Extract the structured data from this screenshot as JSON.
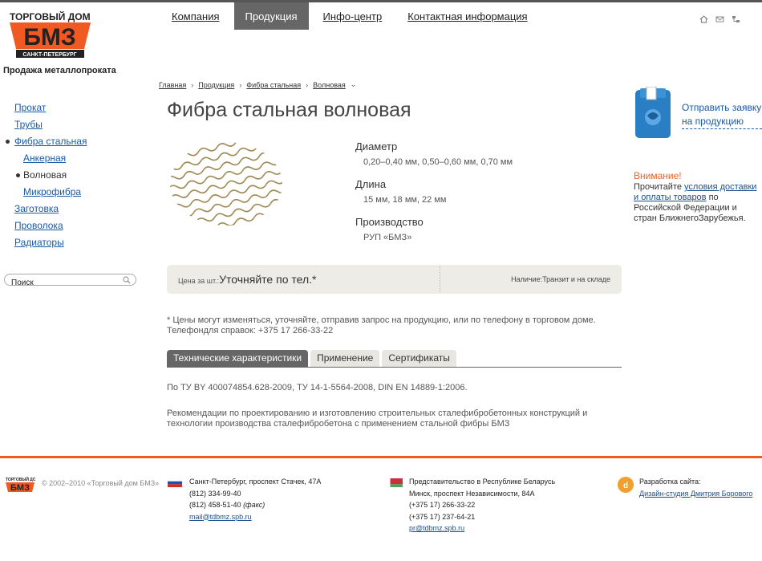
{
  "brand": {
    "logo_top": "ТОРГОВЫЙ ДОМ",
    "logo_main": "БМЗ",
    "logo_city": "САНКТ-ПЕТЕРБУРГ",
    "tagline": "Продажа металлопроката"
  },
  "topnav": [
    {
      "label": "Компания",
      "active": false
    },
    {
      "label": "Продукция",
      "active": true
    },
    {
      "label": "Инфо-центр",
      "active": false
    },
    {
      "label": "Контактная информация",
      "active": false
    }
  ],
  "top_icons": [
    "home-icon",
    "mail-icon",
    "sitemap-icon"
  ],
  "sidebar": {
    "items": [
      {
        "label": "Прокат"
      },
      {
        "label": "Трубы"
      },
      {
        "label": "Фибра стальная"
      },
      {
        "label": "Анкерная"
      },
      {
        "label": "Волновая"
      },
      {
        "label": "Микрофибра"
      },
      {
        "label": "Заготовка"
      },
      {
        "label": "Проволока"
      },
      {
        "label": "Радиаторы"
      }
    ]
  },
  "search": {
    "value": "Поиск"
  },
  "breadcrumb": [
    "Главная",
    "Продукция",
    "Фибра стальная",
    "Волновая"
  ],
  "title": "Фибра стальная волновая",
  "properties": [
    {
      "label": "Диаметр",
      "value": "0,20–0,40 мм, 0,50–0,60 мм, 0,70 мм"
    },
    {
      "label": "Длина",
      "value": "15 мм, 18 мм, 22 мм"
    },
    {
      "label": "Производство",
      "value": "РУП «БМЗ»"
    }
  ],
  "price": {
    "label": "Цена за шт.:",
    "value": "Уточняйте по тел.*",
    "availability_label": "Наличие:",
    "availability_value": "Транзит и на складе"
  },
  "note": {
    "line1": "* Цены могут изменяться, уточняйте, отправив запрос на продукцию, или по телефону в торговом доме.",
    "line2": "Телефондля справок: +375 17 266-33-22"
  },
  "tabs": [
    {
      "label": "Технические характеристики",
      "active": true
    },
    {
      "label": "Применение",
      "active": false
    },
    {
      "label": "Сертификаты",
      "active": false
    }
  ],
  "tab_content": {
    "standards": "По ТУ BY 400074854.628-2009, ТУ 14-1-5564-2008, DIN EN 14889-1:2006.",
    "recommendations": "Рекомендации по проектированию и изготовлению строительных сталефибробетонных конструкций и технологии производства сталефибробетона с применением стальной фибры БМЗ"
  },
  "promo": {
    "link": "Отправить заявку на продукцию"
  },
  "attention": {
    "title": "Внимание!",
    "pre": "Прочитайте ",
    "link": "условия доставки и оплаты товаров",
    "post": " по Российской Федерации и стран БлижнегоЗарубежья."
  },
  "footer": {
    "copyright": "© 2002–2010 «Торговый дом БМЗ»",
    "spb": {
      "address": "Санкт-Петербург, проспект Стачек, 47А",
      "phone1": "(812) 334-99-40",
      "phone2": "(812) 458-51-40",
      "fax": "(факс)",
      "email": "mail@tdbmz.spb.ru"
    },
    "by": {
      "title": "Представительство в Республике Беларусь",
      "address": "Минск, проспект Независимости, 84А",
      "phone1": "(+375 17) 266-33-22",
      "phone2": "(+375 17) 237-64-21",
      "email": "pr@tdbmz.spb.ru"
    },
    "dev": {
      "label": "Разработка сайта:",
      "link": "Дизайн-студия Дмитрия Борового"
    }
  },
  "colors": {
    "accent": "#f05a22",
    "nav_active": "#666666",
    "link": "#1a5aa6"
  }
}
